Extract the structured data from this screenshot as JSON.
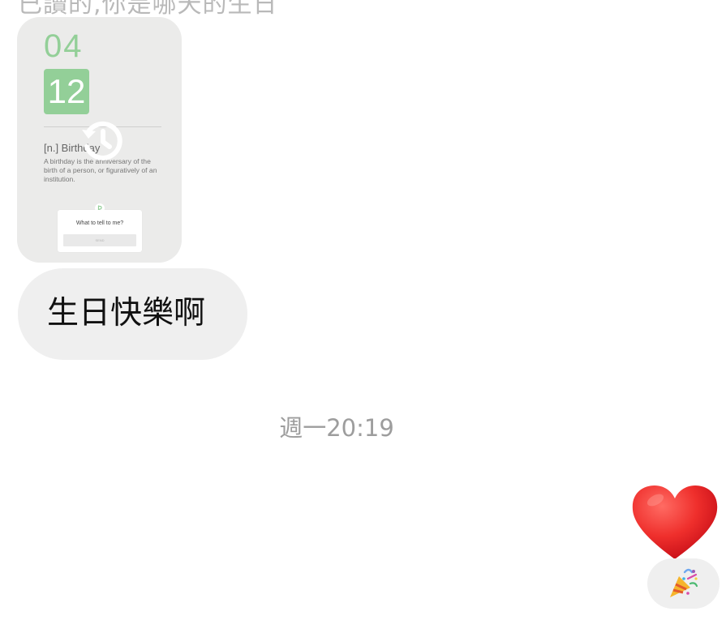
{
  "conversation": {
    "top_clipped_text": "已讀的,你是哪天的生日",
    "shared_story": {
      "month": "04",
      "day": "12",
      "term": "[n.] Birthday",
      "definition": "A birthday is the anniversary of the birth of a person, or figuratively of an institution.",
      "prompt": "What to tell to me?",
      "prompt_button": "SEND"
    },
    "received_message": "生日快樂啊",
    "timestamp": "週一20:19",
    "heart_reaction_icon": "heart-icon",
    "sent_reaction_icon": "party-popper-icon"
  },
  "colors": {
    "accent_green": "#93cf98",
    "bubble_gray": "#efefef",
    "card_gray": "#ebebea",
    "timestamp_gray": "#9d9d9d",
    "heart_red": "#e8252e"
  }
}
